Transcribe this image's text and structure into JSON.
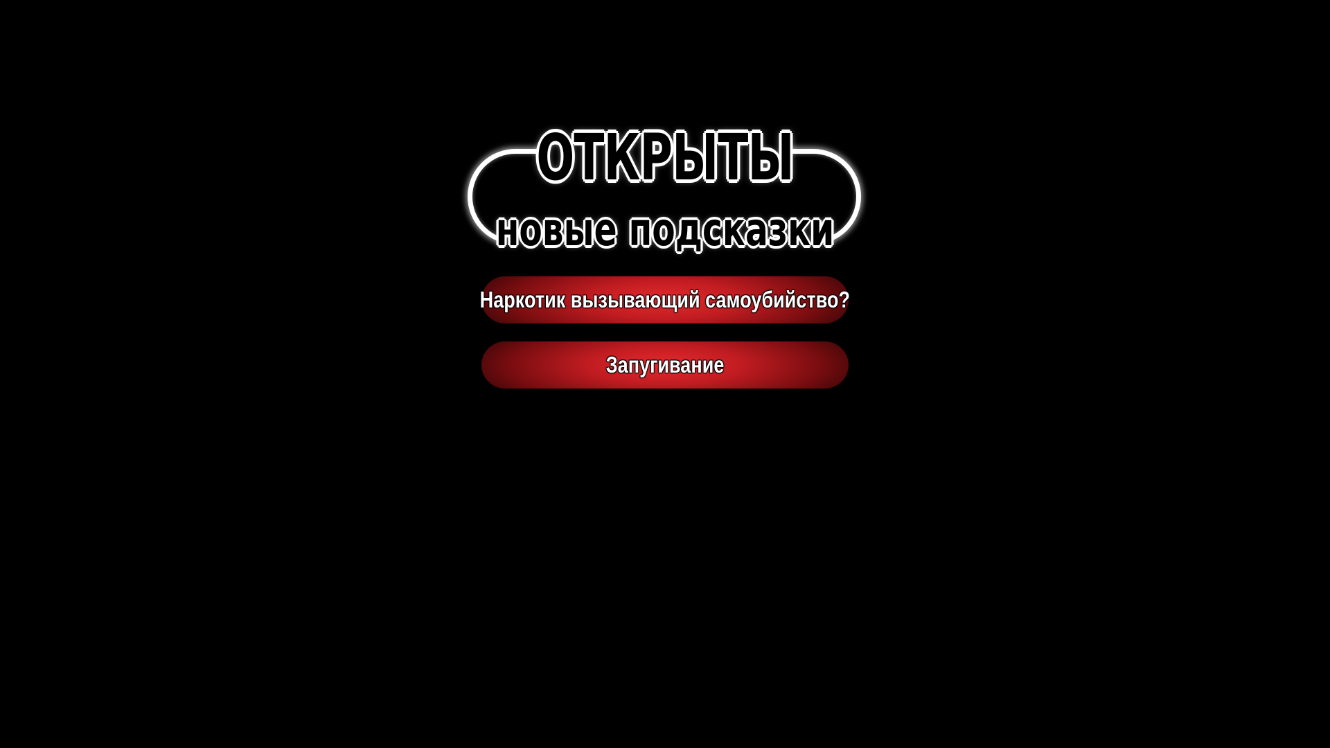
{
  "header": {
    "title": "ОТКРЫТЫ",
    "subtitle": "новые подсказки"
  },
  "options": [
    {
      "label": "Наркотик вызывающий самоубийство?"
    },
    {
      "label": "Запугивание"
    }
  ],
  "colors": {
    "background": "#000000",
    "button_red": "#e62a2e",
    "button_dark": "#7a0d10",
    "badge_outline": "#ffffff"
  }
}
